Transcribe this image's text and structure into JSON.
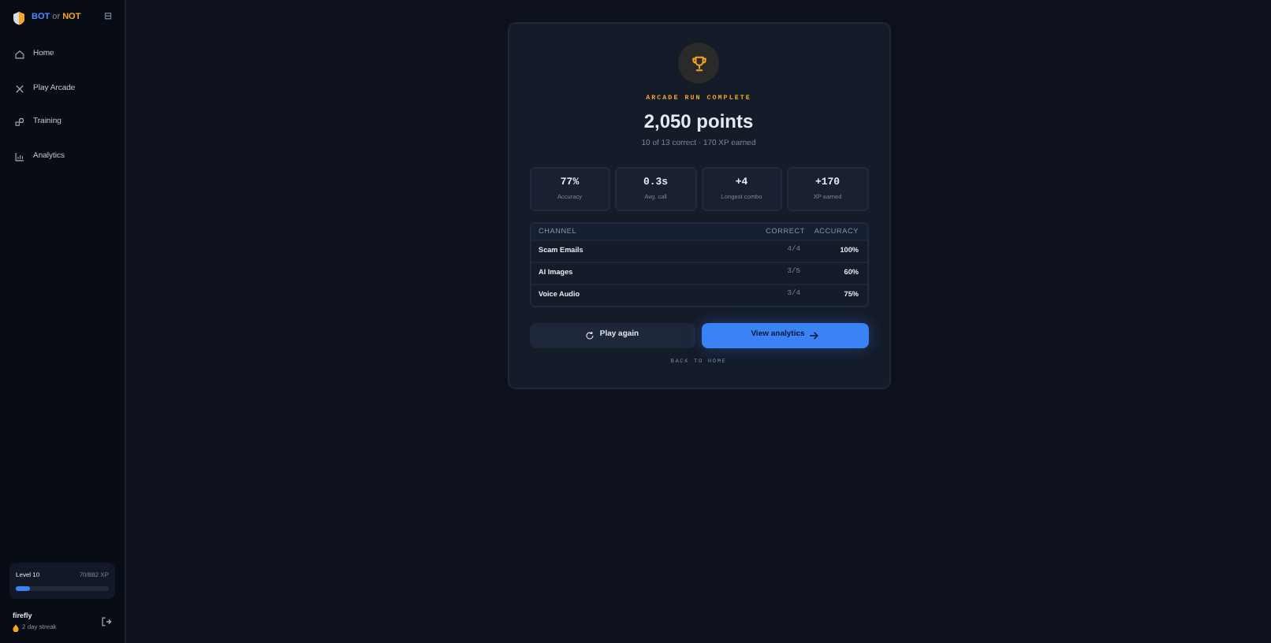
{
  "sidebar": {
    "brand": {
      "part_1": "BOT",
      "part_2": "or",
      "part_3": "NOT"
    },
    "collapse_symbol": "⊟",
    "items": [
      {
        "label": "Home",
        "selected": false
      },
      {
        "label": "Play Arcade",
        "selected": false
      },
      {
        "label": "Training",
        "selected": false
      },
      {
        "label": "Analytics",
        "selected": false
      }
    ],
    "level": {
      "label": "Level 10",
      "xp": "70/882 XP",
      "level": 0.15
    },
    "user": {
      "name": "firefly",
      "streak": "2 day streak"
    }
  },
  "result": {
    "eyebrow": "ARCADE RUN COMPLETE",
    "points": "2,050 points",
    "summary": "10 of 13 correct · 170 XP earned",
    "stats": [
      {
        "value": "77%",
        "label": "Accuracy"
      },
      {
        "value": "0.3s",
        "label": "Avg. call"
      },
      {
        "value": "+4",
        "label": "Longest combo"
      },
      {
        "value": "+170",
        "label": "XP earned"
      }
    ],
    "table": {
      "columns": [
        "CHANNEL",
        "CORRECT",
        "ACCURACY"
      ],
      "rows": [
        {
          "channel": "Scam Emails",
          "correct": "4/4",
          "accuracy": "100%"
        },
        {
          "channel": "AI Images",
          "correct": "3/5",
          "accuracy": "60%"
        },
        {
          "channel": "Voice Audio",
          "correct": "3/4",
          "accuracy": "75%"
        }
      ]
    },
    "buttons": [
      {
        "label": "Play again",
        "kind": "secondary"
      },
      {
        "label": "View analytics",
        "kind": "primary"
      }
    ],
    "back_link": "BACK TO HOME"
  }
}
